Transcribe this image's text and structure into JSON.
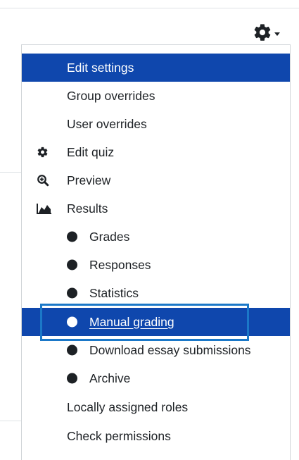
{
  "toolbar": {
    "gear_icon": "gear-icon",
    "caret_icon": "caret-down-icon"
  },
  "menu": {
    "items": [
      {
        "label": "Edit settings",
        "type": "plain",
        "active": true
      },
      {
        "label": "Group overrides",
        "type": "plain"
      },
      {
        "label": "User overrides",
        "type": "plain"
      },
      {
        "label": "Edit quiz",
        "type": "icon",
        "icon": "gear-icon"
      },
      {
        "label": "Preview",
        "type": "icon",
        "icon": "zoom-in-icon"
      },
      {
        "label": "Results",
        "type": "icon",
        "icon": "area-chart-icon"
      },
      {
        "label": "Grades",
        "type": "sub"
      },
      {
        "label": "Responses",
        "type": "sub"
      },
      {
        "label": "Statistics",
        "type": "sub"
      },
      {
        "label": "Manual grading",
        "type": "sub",
        "active": true,
        "link": true
      },
      {
        "label": "Download essay submissions",
        "type": "sub"
      },
      {
        "label": "Archive",
        "type": "sub"
      },
      {
        "label": "Locally assigned roles",
        "type": "plain"
      },
      {
        "label": "Check permissions",
        "type": "plain"
      }
    ]
  },
  "colors": {
    "active_background": "#0f47ad",
    "text": "#1d2125",
    "highlight_border": "#1b78c8"
  }
}
